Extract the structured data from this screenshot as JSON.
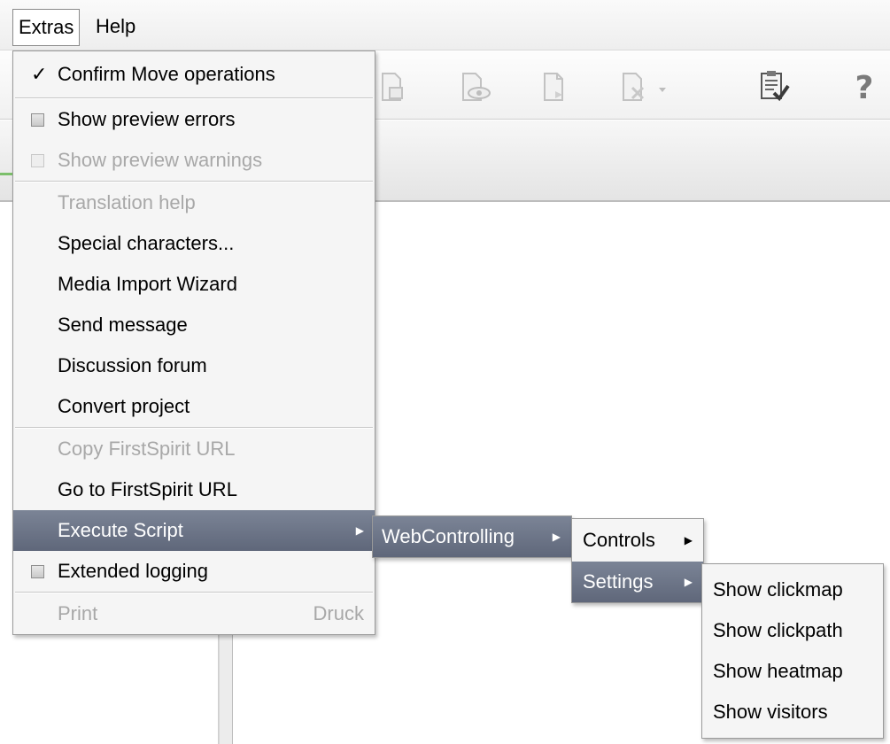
{
  "menubar": {
    "extras": "Extras",
    "help": "Help"
  },
  "toolbar": {
    "icons": [
      "page-icon",
      "preview-icon",
      "document-icon",
      "document-dropdown-icon",
      "checklist-icon",
      "help-icon"
    ]
  },
  "extras_menu": {
    "confirm_move": {
      "check": "✓",
      "label": "Confirm Move operations"
    },
    "show_preview_errors": "Show preview errors",
    "show_preview_warnings": "Show preview warnings",
    "translation_help": "Translation help",
    "special_characters": "Special characters...",
    "media_import_wizard": "Media Import Wizard",
    "send_message": "Send message",
    "discussion_forum": "Discussion forum",
    "convert_project": "Convert project",
    "copy_firstspirit_url": "Copy FirstSpirit URL",
    "go_to_firstspirit_url": "Go to FirstSpirit URL",
    "execute_script": "Execute Script",
    "extended_logging": "Extended logging",
    "print": {
      "label": "Print",
      "shortcut": "Druck"
    },
    "arrow": "▶"
  },
  "script_menu": {
    "webcontrolling": "WebControlling"
  },
  "webcontrolling_menu": {
    "controls": "Controls",
    "settings": "Settings"
  },
  "settings_menu": {
    "show_clickmap": "Show clickmap",
    "show_clickpath": "Show clickpath",
    "show_heatmap": "Show heatmap",
    "show_visitors": "Show visitors"
  }
}
